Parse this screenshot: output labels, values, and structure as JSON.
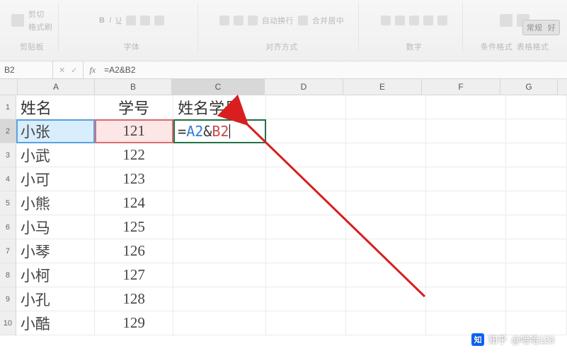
{
  "ribbon": {
    "groups": {
      "clipboard": "剪贴板",
      "font": "字体",
      "align": "对齐方式",
      "number": "数字"
    },
    "paste": "粘贴",
    "cut": "剪切",
    "format_painter": "格式刷",
    "wrap": "自动换行",
    "merge": "合并居中",
    "cond_fmt": "条件格式",
    "cell_style": "表格格式",
    "general": "常规",
    "ok": "好"
  },
  "name_box": "B2",
  "formula_bar": "=A2&B2",
  "columns": [
    "A",
    "B",
    "C",
    "D",
    "E",
    "F",
    "G"
  ],
  "row_numbers": [
    "1",
    "2",
    "3",
    "4",
    "5",
    "6",
    "7",
    "8",
    "9",
    "10"
  ],
  "header_row": {
    "A": "姓名",
    "B": "学号",
    "C": "姓名学号"
  },
  "data": [
    {
      "A": "小张",
      "B": "121"
    },
    {
      "A": "小武",
      "B": "122"
    },
    {
      "A": "小可",
      "B": "123"
    },
    {
      "A": "小熊",
      "B": "124"
    },
    {
      "A": "小马",
      "B": "125"
    },
    {
      "A": "小琴",
      "B": "126"
    },
    {
      "A": "小柯",
      "B": "127"
    },
    {
      "A": "小孔",
      "B": "128"
    },
    {
      "A": "小酷",
      "B": "129"
    }
  ],
  "editing_cell": {
    "eq": "=",
    "refA": "A2",
    "amp": "&",
    "refB": "B2"
  },
  "watermark": {
    "brand": "知",
    "label": "知乎",
    "author": "@哈哈123"
  }
}
